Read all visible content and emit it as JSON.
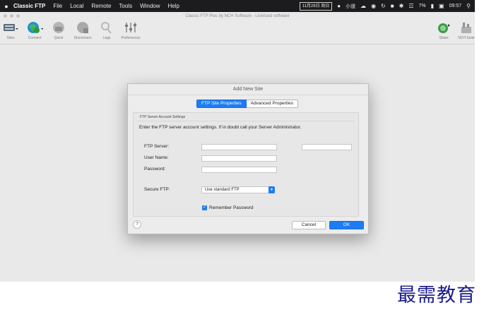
{
  "menubar": {
    "app_name": "Classic FTP",
    "items": [
      "File",
      "Local",
      "Remote",
      "Tools",
      "Window",
      "Help"
    ],
    "status": {
      "date": "11月28日 周日",
      "ime": "小道",
      "battery": "7%",
      "time": "09:57"
    }
  },
  "window": {
    "title": "Classic FTP Plus by NCH Software - Licensed software"
  },
  "toolbar": {
    "items": [
      {
        "label": "Sites",
        "icon": "server-icon"
      },
      {
        "label": "Connect",
        "icon": "globe-icon"
      },
      {
        "label": "Quick",
        "icon": "quick-connect-icon"
      },
      {
        "label": "Disconnect",
        "icon": "disconnect-icon"
      },
      {
        "label": "Logs",
        "icon": "logs-icon"
      },
      {
        "label": "Preferences",
        "icon": "preferences-icon"
      }
    ],
    "right_items": [
      {
        "label": "Share",
        "icon": "share-icon"
      },
      {
        "label": "NCH Suite",
        "icon": "nch-suite-icon"
      }
    ]
  },
  "dialog": {
    "title": "Add New Site",
    "tabs": [
      "FTP Site Properties",
      "Advanced Properties"
    ],
    "active_tab": "FTP Site Properties",
    "group_title": "FTP Server Account Settings",
    "instructions": "Enter the FTP server account settings. If in doubt call your Server Administrator.",
    "fields": {
      "ftp_server_label": "FTP Server:",
      "ftp_server_value": "",
      "port_value": "",
      "user_name_label": "User Name:",
      "user_name_value": "",
      "password_label": "Password:",
      "password_value": ""
    },
    "remember_password": {
      "label": "Remember Password",
      "checked": true
    },
    "secure_ftp": {
      "label": "Secure FTP:",
      "value": "Use standard FTP"
    },
    "help_label": "?",
    "cancel_label": "Cancel",
    "ok_label": "OK"
  },
  "watermark": "最需教育",
  "colors": {
    "accent": "#1e7cf2",
    "menubar": "#1c1c1e",
    "window_bg": "#e9e9e9"
  }
}
